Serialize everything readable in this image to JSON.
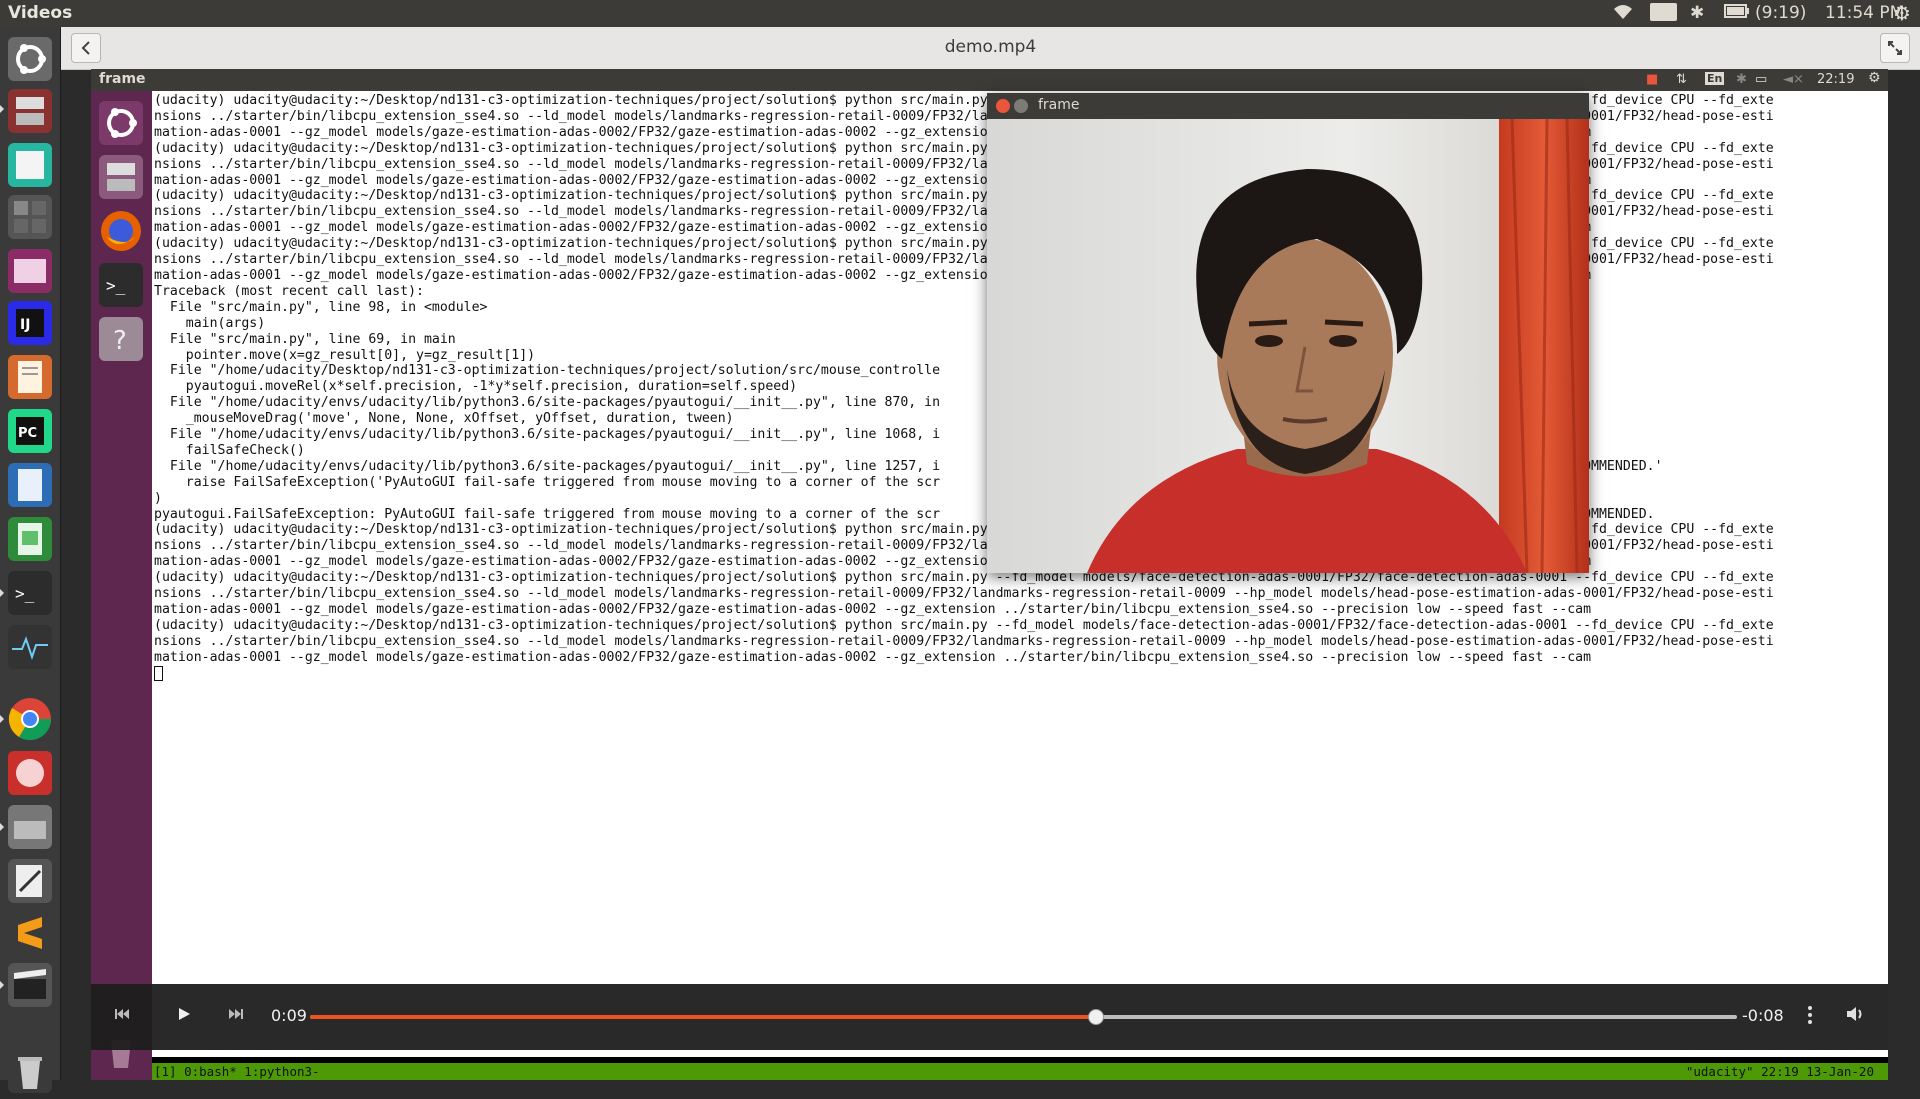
{
  "top_panel": {
    "app_name": "Videos",
    "keyboard_lang": "En",
    "battery": "(9:19)",
    "clock": "11:54 PM"
  },
  "header": {
    "title": "demo.mp4"
  },
  "inner_desktop": {
    "panel_title": "frame",
    "keyboard_lang": "En",
    "clock": "22:19"
  },
  "terminal": {
    "lines": [
      "(udacity) udacity@udacity:~/Desktop/nd131-c3-optimization-techniques/project/solution$ python src/main.py --fd_model models/face-detection-adas-0001/FP32/face-detection-adas-0001 --fd_device CPU --fd_exte",
      "nsions ../starter/bin/libcpu_extension_sse4.so --ld_model models/landmarks-regression-retail-0009/FP32/landmarks-regression-retail-0009 --hp_model models/head-pose-estimation-adas-0001/FP32/head-pose-esti",
      "mation-adas-0001 --gz_model models/gaze-estimation-adas-0002/FP32/gaze-estimation-adas-0002 --gz_extension ../starter/bin/libcpu_extension_sse4.so --precision low --speed fast --cam",
      "(udacity) udacity@udacity:~/Desktop/nd131-c3-optimization-techniques/project/solution$ python src/main.py --fd_model models/face-detection-adas-0001/FP32/face-detection-adas-0001 --fd_device CPU --fd_exte",
      "nsions ../starter/bin/libcpu_extension_sse4.so --ld_model models/landmarks-regression-retail-0009/FP32/landmarks-regression-retail-0009 --hp_model models/head-pose-estimation-adas-0001/FP32/head-pose-esti",
      "mation-adas-0001 --gz_model models/gaze-estimation-adas-0002/FP32/gaze-estimation-adas-0002 --gz_extension ../starter/bin/libcpu_extension_sse4.so --precision low --speed fast --cam",
      "(udacity) udacity@udacity:~/Desktop/nd131-c3-optimization-techniques/project/solution$ python src/main.py --fd_model models/face-detection-adas-0001/FP32/face-detection-adas-0001 --fd_device CPU --fd_exte",
      "nsions ../starter/bin/libcpu_extension_sse4.so --ld_model models/landmarks-regression-retail-0009/FP32/landmarks-regression-retail-0009 --hp_model models/head-pose-estimation-adas-0001/FP32/head-pose-esti",
      "mation-adas-0001 --gz_model models/gaze-estimation-adas-0002/FP32/gaze-estimation-adas-0002 --gz_extension ../starter/bin/libcpu_extension_sse4.so --precision low --speed fast --cam",
      "(udacity) udacity@udacity:~/Desktop/nd131-c3-optimization-techniques/project/solution$ python src/main.py --fd_model models/face-detection-adas-0001/FP32/face-detection-adas-0001 --fd_device CPU --fd_exte",
      "nsions ../starter/bin/libcpu_extension_sse4.so --ld_model models/landmarks-regression-retail-0009/FP32/landmarks-regression-retail-0009 --hp_model models/head-pose-estimation-adas-0001/FP32/head-pose-esti",
      "mation-adas-0001 --gz_model models/gaze-estimation-adas-0002/FP32/gaze-estimation-adas-0002 --gz_extension ../starter/bin/libcpu_extension_sse4.so --precision low --speed fast --cam",
      "Traceback (most recent call last):",
      "  File \"src/main.py\", line 98, in <module>",
      "    main(args)",
      "  File \"src/main.py\", line 69, in main",
      "    pointer.move(x=gz_result[0], y=gz_result[1])",
      "  File \"/home/udacity/Desktop/nd131-c3-optimization-techniques/project/solution/src/mouse_controlle",
      "    pyautogui.moveRel(x*self.precision, -1*y*self.precision, duration=self.speed)",
      "  File \"/home/udacity/envs/udacity/lib/python3.6/site-packages/pyautogui/__init__.py\", line 870, in",
      "    _mouseMoveDrag('move', None, None, xOffset, yOffset, duration, tween)",
      "  File \"/home/udacity/envs/udacity/lib/python3.6/site-packages/pyautogui/__init__.py\", line 1068, i",
      "    failSafeCheck()",
      "  File \"/home/udacity/envs/udacity/lib/python3.6/site-packages/pyautogui/__init__.py\", line 1257, i                                                         ING FAIL-SAFE IS NOT RECOMMENDED.'",
      "    raise FailSafeException('PyAutoGUI fail-safe triggered from mouse moving to a corner of the scr",
      ")",
      "pyautogui.FailSafeException: PyAutoGUI fail-safe triggered from mouse moving to a corner of the scr                                                         ING FAIL-SAFE IS NOT RECOMMENDED.",
      "(udacity) udacity@udacity:~/Desktop/nd131-c3-optimization-techniques/project/solution$ python src/main.py --fd_model models/face-detection-adas-0001/FP32/face-detection-adas-0001 --fd_device CPU --fd_exte",
      "nsions ../starter/bin/libcpu_extension_sse4.so --ld_model models/landmarks-regression-retail-0009/FP32/landmarks-regression-retail-0009 --hp_model models/head-pose-estimation-adas-0001/FP32/head-pose-esti",
      "mation-adas-0001 --gz_model models/gaze-estimation-adas-0002/FP32/gaze-estimation-adas-0002 --gz_extension ../starter/bin/libcpu_extension_sse4.so --precision low --speed fast --cam",
      "(udacity) udacity@udacity:~/Desktop/nd131-c3-optimization-techniques/project/solution$ python src/main.py --fd_model models/face-detection-adas-0001/FP32/face-detection-adas-0001 --fd_device CPU --fd_exte",
      "nsions ../starter/bin/libcpu_extension_sse4.so --ld_model models/landmarks-regression-retail-0009/FP32/landmarks-regression-retail-0009 --hp_model models/head-pose-estimation-adas-0001/FP32/head-pose-esti",
      "mation-adas-0001 --gz_model models/gaze-estimation-adas-0002/FP32/gaze-estimation-adas-0002 --gz_extension ../starter/bin/libcpu_extension_sse4.so --precision low --speed fast --cam",
      "(udacity) udacity@udacity:~/Desktop/nd131-c3-optimization-techniques/project/solution$ python src/main.py --fd_model models/face-detection-adas-0001/FP32/face-detection-adas-0001 --fd_device CPU --fd_exte",
      "nsions ../starter/bin/libcpu_extension_sse4.so --ld_model models/landmarks-regression-retail-0009/FP32/landmarks-regression-retail-0009 --hp_model models/head-pose-estimation-adas-0001/FP32/head-pose-esti",
      "mation-adas-0001 --gz_model models/gaze-estimation-adas-0002/FP32/gaze-estimation-adas-0002 --gz_extension ../starter/bin/libcpu_extension_sse4.so --precision low --speed fast --cam"
    ],
    "tmux_left": "[1] 0:bash* 1:python3-",
    "tmux_right": "\"udacity\" 22:19 13-Jan-20"
  },
  "frame_window": {
    "title": "frame"
  },
  "player": {
    "elapsed": "0:09",
    "remaining": "-0:08",
    "progress": 0.55
  },
  "colors": {
    "accent": "#e95420",
    "terminal_bg": "#ffffff",
    "launcher_inner": "#5e2750",
    "tmux_bar": "#4e9a06"
  },
  "icons": {
    "prev": "skip-previous-icon",
    "play": "play-icon",
    "next": "skip-next-icon",
    "menu": "vertical-dots-icon",
    "volume": "volume-icon"
  }
}
